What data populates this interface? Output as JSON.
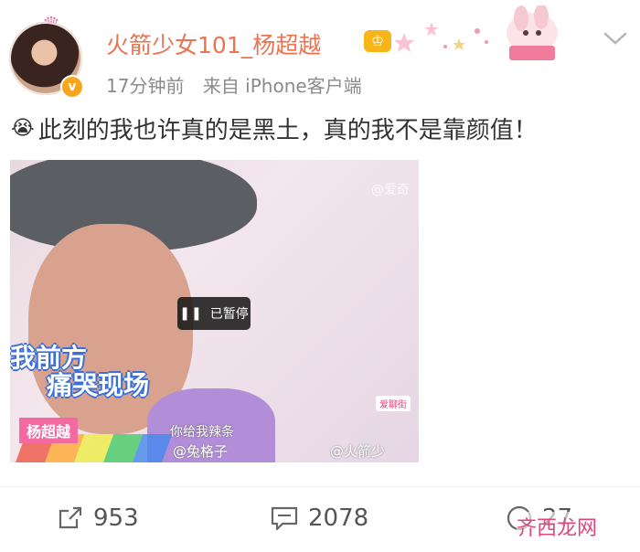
{
  "user": {
    "name": "火箭少女101_杨超越",
    "time": "17分钟前",
    "source": "来自 iPhone客户端"
  },
  "post": {
    "emoji": "😭",
    "text": "此刻的我也许真的是黑土，真的我不是靠颜值！"
  },
  "video": {
    "status": "已暂停",
    "caption_line1": "我前方",
    "caption_line2": "痛哭现场",
    "name_tag": "杨超越",
    "subtitle": "你给我辣条",
    "watermark_left": "@兔格子",
    "watermark_right": "@火箭少",
    "watermark_top": "@爱奇",
    "channel_badge": "爱聊街"
  },
  "actions": {
    "share_count": "953",
    "comment_count": "2078",
    "like_count": "27"
  },
  "footer_watermark": "齐西龙网",
  "icons": {
    "share": "share-icon",
    "comment": "comment-icon",
    "like": "like-icon",
    "more": "chevron-down-icon"
  },
  "colors": {
    "username": "#eb7350",
    "meta": "#8b8b8b",
    "text": "#333333",
    "badge": "#f7a51a"
  }
}
